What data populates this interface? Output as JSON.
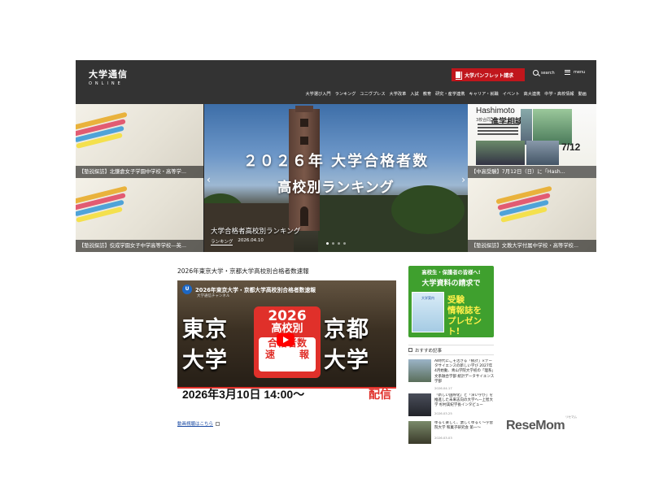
{
  "header": {
    "logo_main": "大学通信",
    "logo_sub": "ONLINE",
    "pamphlet_label": "大学パンフレット請求",
    "search_label": "search",
    "menu_label": "menu",
    "nav": [
      "大学選び入門",
      "ランキング",
      "ユニヴプレス",
      "大学改革",
      "入試",
      "教育",
      "研究・産学連携",
      "キャリア・就職",
      "イベント",
      "高大連携",
      "中学・高校情報",
      "動画"
    ]
  },
  "carousel": {
    "left_tiles": [
      {
        "caption": "【塾説探訪】北鎌倉女子学園中学校・高等学..."
      },
      {
        "caption": "【塾説探訪】佼成学園女子中学高等学校―英..."
      }
    ],
    "main": {
      "title_line1": "２０２６年 大学合格者数",
      "title_line2": "高校別ランキング",
      "caption": "大学合格者高校別ランキング",
      "tag": "ランキング",
      "date": "2026.04.10"
    },
    "right_tiles": [
      {
        "caption": "【中高受験】7月12日（日）に「Hash...",
        "poster_title": "Hashimoto",
        "poster_sub": "3校合同",
        "poster_big": "進学相談会",
        "poster_date": "7/12"
      },
      {
        "caption": "【塾説探訪】文教大学付属中学校・高等学校..."
      }
    ]
  },
  "main": {
    "section_title": "2026年東京大学・京都大学高校別合格者数速報",
    "video": {
      "title": "2026年東京大学・京都大学高校別合格者数速報",
      "channel": "大学通信チャンネル",
      "logo": "U",
      "left_big": [
        "東京",
        "大学"
      ],
      "right_big": [
        "京都",
        "大学"
      ],
      "box_year": "2026",
      "box_line1": "高校別",
      "box_line2": "合格者数",
      "box_line3": "速",
      "box_line4": "報",
      "date_text": "2026年3月10日 14:00〜",
      "live_text": "配信"
    },
    "video_link": "動画視聴はこちら"
  },
  "sidebar": {
    "promo": {
      "line1": "高校生・保護者の皆様へ!",
      "line2": "大学資料の請求で",
      "book_label": "大学案内",
      "highlight": [
        "受験",
        "情報誌を",
        "プレゼント!"
      ]
    },
    "recommended_title": "おすすめ記事",
    "articles": [
      {
        "text": "AI時代にこそ活きる「統計」×データサイエンスの新しい学び 2027年4月始動、青山学院大学初の「理系」文系融合学部 統計データサイエンス学部",
        "date": "2026.04.17"
      },
      {
        "text": "「新しい国際化」と「深い学び」を推進した未来志向の大学へ―上智大学 杉村美紀学長インタビュー",
        "date": "2026.03.25"
      },
      {
        "text": "ゆるく楽しく、激しくゆるく〜学習院大学 和菓子研究会 第一〜",
        "date": "2026.03.03"
      }
    ]
  },
  "brand": {
    "name": "ReseMom",
    "ruby": "リセマム"
  },
  "colors": {
    "header_bg": "#333333",
    "accent_red": "#c0161c",
    "promo_green": "#3fa02e",
    "link_blue": "#1a4aa3"
  }
}
